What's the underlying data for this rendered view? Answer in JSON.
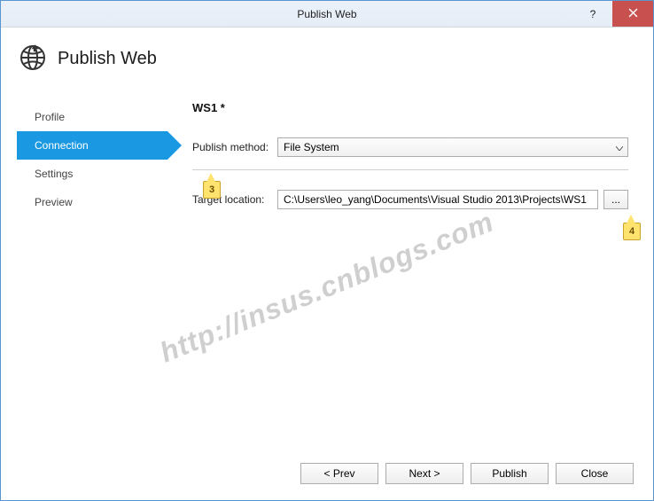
{
  "titlebar": {
    "title": "Publish Web",
    "help_label": "?",
    "close_label": "Close"
  },
  "header": {
    "title": "Publish Web"
  },
  "sidebar": {
    "items": [
      {
        "label": "Profile",
        "active": false
      },
      {
        "label": "Connection",
        "active": true
      },
      {
        "label": "Settings",
        "active": false
      },
      {
        "label": "Preview",
        "active": false
      }
    ]
  },
  "main": {
    "profile_name": "WS1 *",
    "publish_method_label": "Publish method:",
    "publish_method_value": "File System",
    "target_location_label": "Target location:",
    "target_location_value": "C:\\Users\\leo_yang\\Documents\\Visual Studio 2013\\Projects\\WS1",
    "browse_label": "..."
  },
  "footer": {
    "prev": "< Prev",
    "next": "Next >",
    "publish": "Publish",
    "close": "Close"
  },
  "callouts": {
    "c3": "3",
    "c4": "4"
  },
  "watermark": "http://insus.cnblogs.com"
}
